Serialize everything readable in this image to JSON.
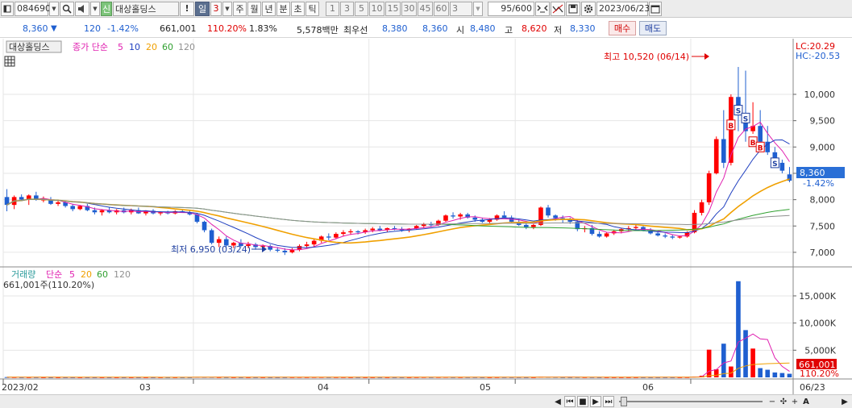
{
  "toolbar": {
    "code": "084690",
    "badge": "신",
    "name": "대상홀딩스",
    "alert": "!",
    "period_day": "일",
    "period_num": "3",
    "periods": [
      "주",
      "월",
      "년",
      "분",
      "초",
      "틱"
    ],
    "intervals": [
      "1",
      "3",
      "5",
      "10",
      "15",
      "30",
      "45",
      "60"
    ],
    "interval_custom": "3",
    "count": "95",
    "count_total": "/600",
    "date": "2023/06/23"
  },
  "quote": {
    "price": "8,360",
    "change": "120",
    "change_pct": "-1.42%",
    "volume": "661,001",
    "volume_ratio": "110.20%",
    "turnover_pct": "1.83%",
    "amount": "5,578백만",
    "best_label": "최우선",
    "ask": "8,380",
    "bid": "8,360",
    "open_label": "시",
    "open": "8,480",
    "high_label": "고",
    "high": "8,620",
    "low_label": "저",
    "low": "8,330",
    "buy_button": "매수",
    "sell_button": "매도"
  },
  "price_panel": {
    "name_label": "대상홀딩스",
    "legend": {
      "title": "종가 단순",
      "ma": [
        "5",
        "10",
        "20",
        "60",
        "120"
      ]
    },
    "lc": "LC:20.29",
    "hc": "HC:-20.53",
    "high_annot": "최고 10,520 (06/14)",
    "low_annot": "최저 6,950 (03/24)",
    "current": "8,360",
    "current_pct": "-1.42%"
  },
  "volume_panel": {
    "legend": {
      "title": "거래량",
      "type": "단순",
      "ma": [
        "5",
        "20",
        "60",
        "120"
      ]
    },
    "info": "661,001주(110.20%)",
    "current": "661,001",
    "current_pct": "110.20%"
  },
  "bottom": {
    "months": [
      "2023/02",
      "03",
      "04",
      "05",
      "06"
    ],
    "right_date": "06/23"
  },
  "colors": {
    "up": "#ff0000",
    "down": "#1f5fd0",
    "ma5": "#e020b0",
    "ma10": "#2040c0",
    "ma20": "#f0a000",
    "ma60": "#30a030",
    "ma120": "#909090",
    "toolbar": "#ececec"
  },
  "icons": {
    "search": "magnifier-icon",
    "speaker": "speaker-icon",
    "calendar": "calendar-icon",
    "settings": "gear-icon",
    "save": "save-icon"
  },
  "chart_data": {
    "type": "candlestick",
    "title": "대상홀딩스",
    "xlabel": "",
    "ylabel": "",
    "y_axis_ticks": [
      7000,
      7500,
      8000,
      8500,
      9000,
      9500,
      10000
    ],
    "ylim": [
      6800,
      10750
    ],
    "volume_axis_ticks": [
      "5,000K",
      "10,000K",
      "15,000K"
    ],
    "volume_ylim": [
      0,
      19000
    ],
    "month_labels": [
      "2023/02",
      "03",
      "04",
      "05",
      "06"
    ],
    "ohlc": [
      [
        8050,
        8200,
        7780,
        7900
      ],
      [
        7900,
        8080,
        7820,
        8050
      ],
      [
        8050,
        8100,
        7980,
        8000
      ],
      [
        8000,
        8100,
        7900,
        8080
      ],
      [
        8080,
        8150,
        7980,
        8000
      ],
      [
        8000,
        8060,
        7950,
        8000
      ],
      [
        8000,
        8050,
        7900,
        7920
      ],
      [
        7920,
        8000,
        7880,
        7950
      ],
      [
        7950,
        7980,
        7850,
        7880
      ],
      [
        7880,
        7920,
        7780,
        7820
      ],
      [
        7820,
        7900,
        7800,
        7880
      ],
      [
        7880,
        7920,
        7780,
        7800
      ],
      [
        7800,
        7850,
        7720,
        7760
      ],
      [
        7760,
        7820,
        7700,
        7800
      ],
      [
        7800,
        7860,
        7740,
        7760
      ],
      [
        7760,
        7820,
        7720,
        7800
      ],
      [
        7800,
        7850,
        7740,
        7760
      ],
      [
        7760,
        7830,
        7720,
        7800
      ],
      [
        7800,
        7850,
        7730,
        7740
      ],
      [
        7740,
        7800,
        7700,
        7790
      ],
      [
        7790,
        7820,
        7720,
        7740
      ],
      [
        7740,
        7780,
        7700,
        7760
      ],
      [
        7760,
        7790,
        7720,
        7740
      ],
      [
        7740,
        7800,
        7720,
        7780
      ],
      [
        7780,
        7820,
        7750,
        7760
      ],
      [
        7760,
        7790,
        7700,
        7720
      ],
      [
        7720,
        7750,
        7550,
        7580
      ],
      [
        7580,
        7600,
        7380,
        7420
      ],
      [
        7420,
        7450,
        7150,
        7180
      ],
      [
        7180,
        7300,
        7100,
        7250
      ],
      [
        7250,
        7300,
        7100,
        7130
      ],
      [
        7130,
        7200,
        7080,
        7180
      ],
      [
        7180,
        7250,
        7100,
        7120
      ],
      [
        7120,
        7200,
        7080,
        7150
      ],
      [
        7150,
        7180,
        7050,
        7100
      ],
      [
        7100,
        7150,
        7050,
        7120
      ],
      [
        7120,
        7150,
        7020,
        7050
      ],
      [
        7050,
        7100,
        7000,
        7030
      ],
      [
        7030,
        7080,
        6950,
        7000
      ],
      [
        7000,
        7080,
        6980,
        7050
      ],
      [
        7050,
        7150,
        7020,
        7120
      ],
      [
        7120,
        7200,
        7080,
        7150
      ],
      [
        7150,
        7250,
        7100,
        7220
      ],
      [
        7220,
        7320,
        7180,
        7300
      ],
      [
        7300,
        7360,
        7230,
        7280
      ],
      [
        7280,
        7380,
        7250,
        7350
      ],
      [
        7350,
        7420,
        7300,
        7380
      ],
      [
        7380,
        7440,
        7330,
        7400
      ],
      [
        7400,
        7420,
        7340,
        7380
      ],
      [
        7380,
        7450,
        7350,
        7420
      ],
      [
        7420,
        7480,
        7380,
        7450
      ],
      [
        7450,
        7500,
        7400,
        7420
      ],
      [
        7420,
        7470,
        7390,
        7460
      ],
      [
        7460,
        7500,
        7420,
        7440
      ],
      [
        7440,
        7480,
        7390,
        7420
      ],
      [
        7420,
        7460,
        7380,
        7450
      ],
      [
        7450,
        7520,
        7430,
        7500
      ],
      [
        7500,
        7560,
        7460,
        7530
      ],
      [
        7530,
        7580,
        7480,
        7520
      ],
      [
        7520,
        7620,
        7500,
        7600
      ],
      [
        7600,
        7720,
        7580,
        7700
      ],
      [
        7700,
        7760,
        7640,
        7680
      ],
      [
        7680,
        7750,
        7620,
        7720
      ],
      [
        7720,
        7750,
        7640,
        7660
      ],
      [
        7660,
        7700,
        7580,
        7620
      ],
      [
        7620,
        7660,
        7560,
        7580
      ],
      [
        7580,
        7650,
        7540,
        7620
      ],
      [
        7620,
        7720,
        7600,
        7700
      ],
      [
        7700,
        7780,
        7650,
        7660
      ],
      [
        7660,
        7700,
        7560,
        7580
      ],
      [
        7580,
        7640,
        7500,
        7520
      ],
      [
        7520,
        7560,
        7440,
        7480
      ],
      [
        7480,
        7540,
        7440,
        7520
      ],
      [
        7520,
        7870,
        7500,
        7850
      ],
      [
        7850,
        7900,
        7660,
        7700
      ],
      [
        7700,
        7720,
        7600,
        7650
      ],
      [
        7650,
        7700,
        7560,
        7620
      ],
      [
        7620,
        7660,
        7540,
        7580
      ],
      [
        7580,
        7620,
        7400,
        7440
      ],
      [
        7440,
        7500,
        7380,
        7460
      ],
      [
        7460,
        7520,
        7320,
        7350
      ],
      [
        7350,
        7400,
        7280,
        7300
      ],
      [
        7300,
        7380,
        7280,
        7360
      ],
      [
        7360,
        7420,
        7330,
        7400
      ],
      [
        7400,
        7460,
        7360,
        7440
      ],
      [
        7440,
        7500,
        7400,
        7460
      ],
      [
        7460,
        7520,
        7420,
        7480
      ],
      [
        7480,
        7500,
        7400,
        7420
      ],
      [
        7420,
        7460,
        7340,
        7360
      ],
      [
        7360,
        7400,
        7300,
        7320
      ],
      [
        7320,
        7360,
        7270,
        7300
      ],
      [
        7300,
        7340,
        7250,
        7280
      ],
      [
        7280,
        7320,
        7260,
        7300
      ],
      [
        7300,
        7400,
        7280,
        7380
      ],
      [
        7380,
        7800,
        7360,
        7750
      ],
      [
        7750,
        8000,
        7700,
        7950
      ],
      [
        7950,
        8550,
        7900,
        8500
      ],
      [
        8500,
        9200,
        8480,
        9150
      ],
      [
        9150,
        9700,
        8600,
        8700
      ],
      [
        8700,
        10000,
        8650,
        9950
      ],
      [
        9950,
        10520,
        9300,
        9600
      ],
      [
        9600,
        10450,
        9100,
        9300
      ],
      [
        9300,
        9850,
        9250,
        9400
      ],
      [
        9400,
        9700,
        9000,
        9100
      ],
      [
        9100,
        9400,
        8850,
        8900
      ],
      [
        8900,
        9000,
        8650,
        8700
      ],
      [
        8700,
        8760,
        8500,
        8550
      ],
      [
        8480,
        8620,
        8330,
        8360
      ]
    ],
    "volume_k": [
      50,
      40,
      30,
      30,
      30,
      20,
      20,
      20,
      20,
      20,
      20,
      20,
      20,
      20,
      20,
      20,
      20,
      20,
      20,
      20,
      20,
      20,
      20,
      20,
      20,
      20,
      80,
      60,
      60,
      40,
      40,
      30,
      30,
      30,
      30,
      30,
      30,
      30,
      30,
      40,
      50,
      40,
      50,
      50,
      40,
      40,
      40,
      30,
      30,
      30,
      30,
      30,
      30,
      30,
      30,
      30,
      40,
      50,
      40,
      50,
      60,
      40,
      40,
      40,
      40,
      30,
      30,
      40,
      40,
      40,
      40,
      30,
      30,
      120,
      80,
      60,
      40,
      40,
      50,
      40,
      40,
      30,
      30,
      30,
      30,
      30,
      30,
      30,
      30,
      30,
      30,
      30,
      30,
      40,
      150,
      300,
      5100,
      1500,
      6200,
      2000,
      17700,
      8700,
      5300,
      1700,
      1400,
      900,
      800,
      661
    ]
  }
}
